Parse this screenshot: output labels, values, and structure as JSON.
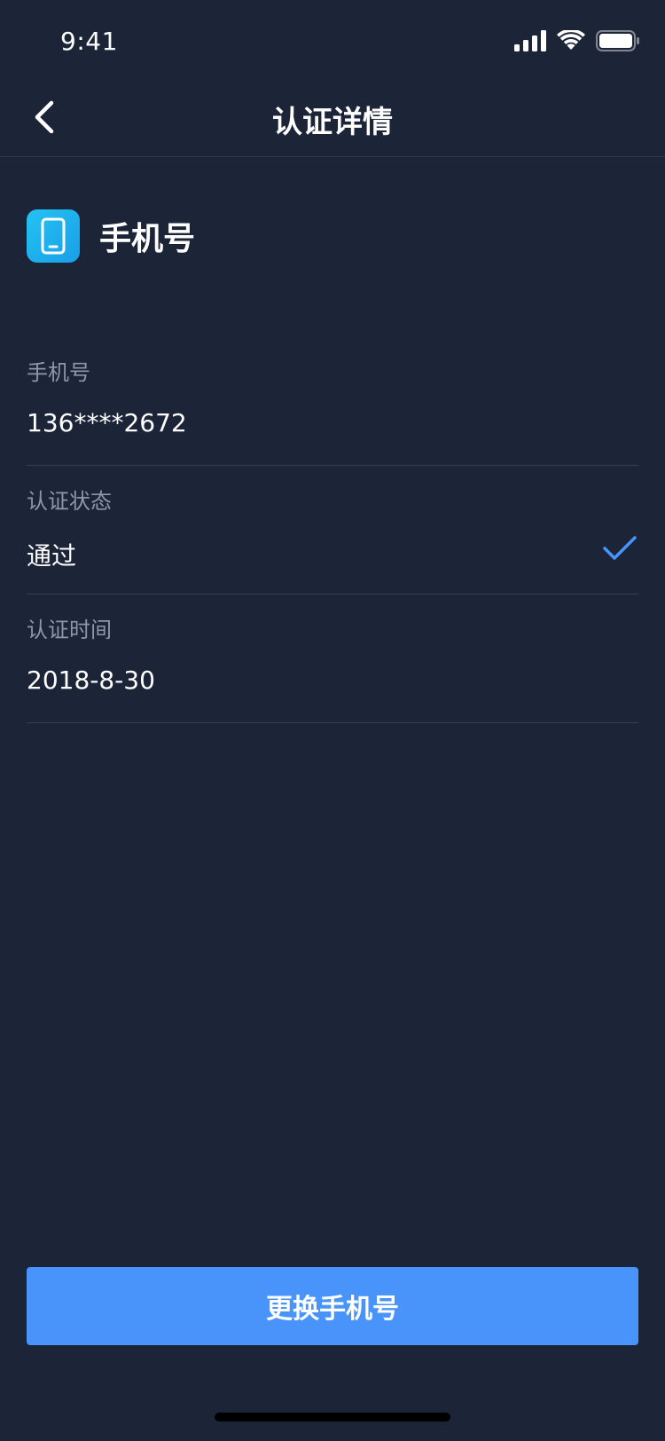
{
  "status_bar": {
    "time": "9:41"
  },
  "nav": {
    "title": "认证详情"
  },
  "header": {
    "title": "手机号"
  },
  "details": [
    {
      "label": "手机号",
      "value": "136****2672"
    },
    {
      "label": "认证状态",
      "value": "通过"
    },
    {
      "label": "认证时间",
      "value": "2018-8-30"
    }
  ],
  "action": {
    "label": "更换手机号"
  },
  "icons": {
    "back": "chevron-left-icon",
    "app": "mobile-phone-icon",
    "status": "checkmark-icon",
    "signal": "cellular-signal-icon",
    "wifi": "wifi-icon",
    "battery": "battery-icon"
  },
  "colors": {
    "background": "#1c2438",
    "accent": "#4894fa",
    "app_icon": "#1fb2ee",
    "label": "#8e96aa",
    "divider": "#353e55"
  }
}
